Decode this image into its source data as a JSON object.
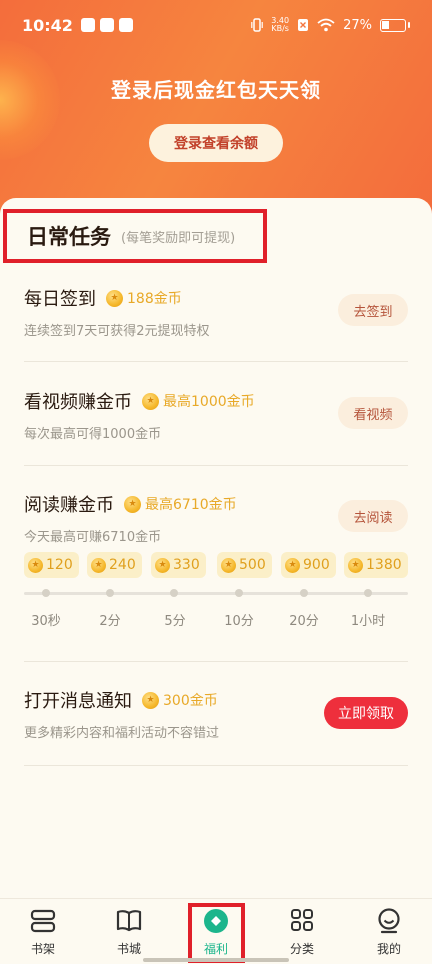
{
  "status_bar": {
    "time": "10:42",
    "net_speed_value": "3.40",
    "net_speed_unit": "KB/s",
    "battery": "27%"
  },
  "hero": {
    "title": "登录后现金红包天天领",
    "button_label": "登录查看余额"
  },
  "section": {
    "title": "日常任务",
    "subtitle": "(每笔奖励即可提现)"
  },
  "tasks": [
    {
      "title": "每日签到",
      "reward": "188金币",
      "desc": "连续签到7天可获得2元提现特权",
      "button": "去签到"
    },
    {
      "title": "看视频赚金币",
      "reward": "最高1000金币",
      "desc": "每次最高可得1000金币",
      "button": "看视频"
    },
    {
      "title": "阅读赚金币",
      "reward": "最高6710金币",
      "desc": "今天最高可赚6710金币",
      "button": "去阅读"
    },
    {
      "title": "打开消息通知",
      "reward": "300金币",
      "desc": "更多精彩内容和福利活动不容错过",
      "button": "立即领取"
    }
  ],
  "reading_milestones": [
    {
      "coins": "120",
      "time": "30秒"
    },
    {
      "coins": "240",
      "time": "2分"
    },
    {
      "coins": "330",
      "time": "5分"
    },
    {
      "coins": "500",
      "time": "10分"
    },
    {
      "coins": "900",
      "time": "20分"
    },
    {
      "coins": "1380",
      "time": "1小时"
    }
  ],
  "reading_progress": 0,
  "bottom_nav": [
    {
      "label": "书架",
      "icon": "bookshelf-icon"
    },
    {
      "label": "书城",
      "icon": "book-icon"
    },
    {
      "label": "福利",
      "icon": "welfare-icon",
      "active": true
    },
    {
      "label": "分类",
      "icon": "grid-icon"
    },
    {
      "label": "我的",
      "icon": "profile-icon"
    }
  ],
  "colors": {
    "accent_red": "#ee2f3c",
    "active_tab": "#1cb58c",
    "coin": "#e8a928"
  }
}
